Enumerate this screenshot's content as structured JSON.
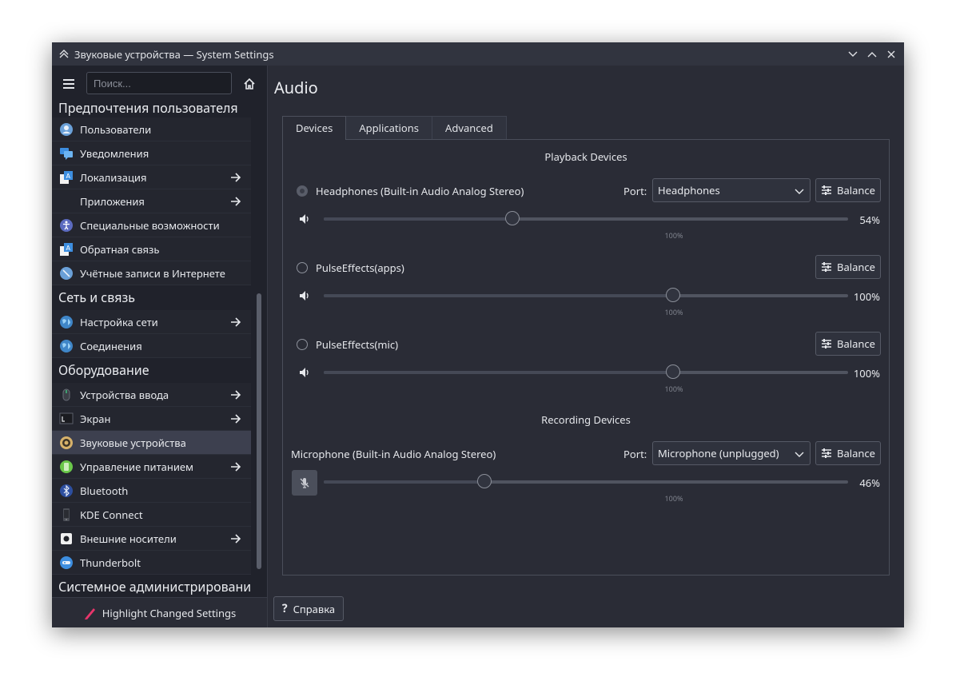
{
  "window": {
    "title": "Звуковые устройства — System Settings"
  },
  "sidebar": {
    "search_placeholder": "Поиск...",
    "categories": [
      {
        "label": "Предпочтения пользователя",
        "items": [
          {
            "label": "Пользователи",
            "icon": "user-icon",
            "arrow": false
          },
          {
            "label": "Уведомления",
            "icon": "chat-bubbles-icon",
            "arrow": false
          },
          {
            "label": "Локализация",
            "icon": "translate-icon",
            "arrow": true
          },
          {
            "label": "Приложения",
            "icon": "",
            "arrow": true
          },
          {
            "label": "Специальные возможности",
            "icon": "accessibility-icon",
            "arrow": false
          },
          {
            "label": "Обратная связь",
            "icon": "feedback-icon",
            "arrow": false
          },
          {
            "label": "Учётные записи в Интернете",
            "icon": "online-accounts-icon",
            "arrow": false
          }
        ]
      },
      {
        "label": "Сеть и связь",
        "items": [
          {
            "label": "Настройка сети",
            "icon": "network-globe-icon",
            "arrow": true
          },
          {
            "label": "Соединения",
            "icon": "connections-globe-icon",
            "arrow": false
          }
        ]
      },
      {
        "label": "Оборудование",
        "items": [
          {
            "label": "Устройства ввода",
            "icon": "mouse-icon",
            "arrow": true
          },
          {
            "label": "Экран",
            "icon": "display-icon",
            "arrow": true
          },
          {
            "label": "Звуковые устройства",
            "icon": "speaker-icon",
            "arrow": false,
            "selected": true
          },
          {
            "label": "Управление питанием",
            "icon": "battery-icon",
            "arrow": true
          },
          {
            "label": "Bluetooth",
            "icon": "bluetooth-icon",
            "arrow": false
          },
          {
            "label": "KDE Connect",
            "icon": "phone-icon",
            "arrow": false
          },
          {
            "label": "Внешние носители",
            "icon": "removable-media-icon",
            "arrow": true
          },
          {
            "label": "Thunderbolt",
            "icon": "thunderbolt-icon",
            "arrow": false
          }
        ]
      },
      {
        "label": "Системное администрировани",
        "items": []
      }
    ],
    "footer_label": "Highlight Changed Settings"
  },
  "main": {
    "title": "Audio",
    "tabs": [
      "Devices",
      "Applications",
      "Advanced"
    ],
    "active_tab": 0,
    "playback_title": "Playback Devices",
    "recording_title": "Recording Devices",
    "port_label": "Port:",
    "balance_label": "Balance",
    "mark_label": "100%",
    "playback_devices": [
      {
        "name": "Headphones (Built-in Audio Analog Stereo)",
        "port": "Headphones",
        "volume": "54%",
        "volume_fraction": 0.54,
        "selected": true,
        "muted": false
      },
      {
        "name": "PulseEffects(apps)",
        "port": "",
        "volume": "100%",
        "volume_fraction": 1.0,
        "selected": false,
        "muted": false
      },
      {
        "name": "PulseEffects(mic)",
        "port": "",
        "volume": "100%",
        "volume_fraction": 1.0,
        "selected": false,
        "muted": false
      }
    ],
    "recording_devices": [
      {
        "name": "Microphone (Built-in Audio Analog Stereo)",
        "port": "Microphone (unplugged)",
        "volume": "46%",
        "volume_fraction": 0.46,
        "muted": true
      }
    ],
    "help_label": "Справка"
  }
}
